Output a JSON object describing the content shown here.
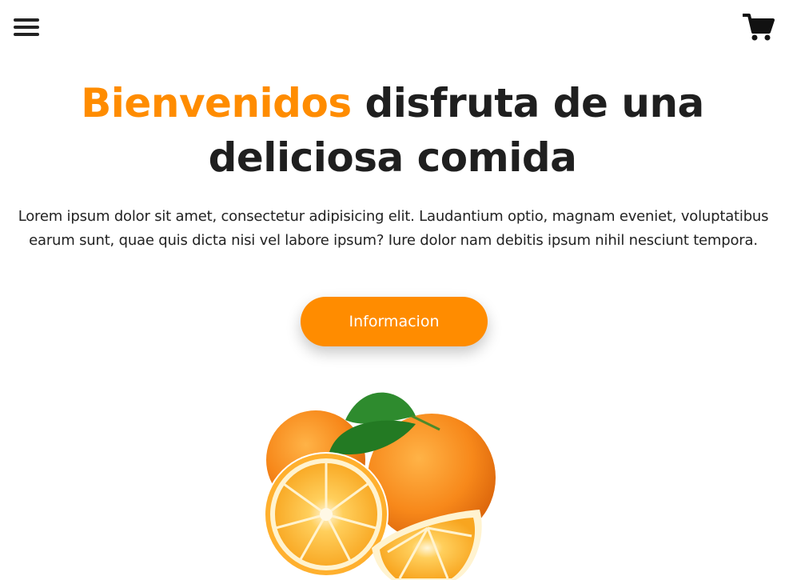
{
  "header": {
    "menu_icon": "hamburger-menu-icon",
    "cart_icon": "shopping-cart-icon"
  },
  "hero": {
    "title_accent": "Bienvenidos",
    "title_rest": " disfruta de una deliciosa comida",
    "description": "Lorem ipsum dolor sit amet, consectetur adipisicing elit. Laudantium optio, magnam eveniet, voluptatibus earum sunt, quae quis dicta nisi vel labore ipsum? Iure dolor nam debitis ipsum nihil nesciunt tempora.",
    "button_label": "Informacion"
  },
  "colors": {
    "accent": "#ff8c00",
    "text": "#1f1f1f",
    "background": "#ffffff"
  }
}
